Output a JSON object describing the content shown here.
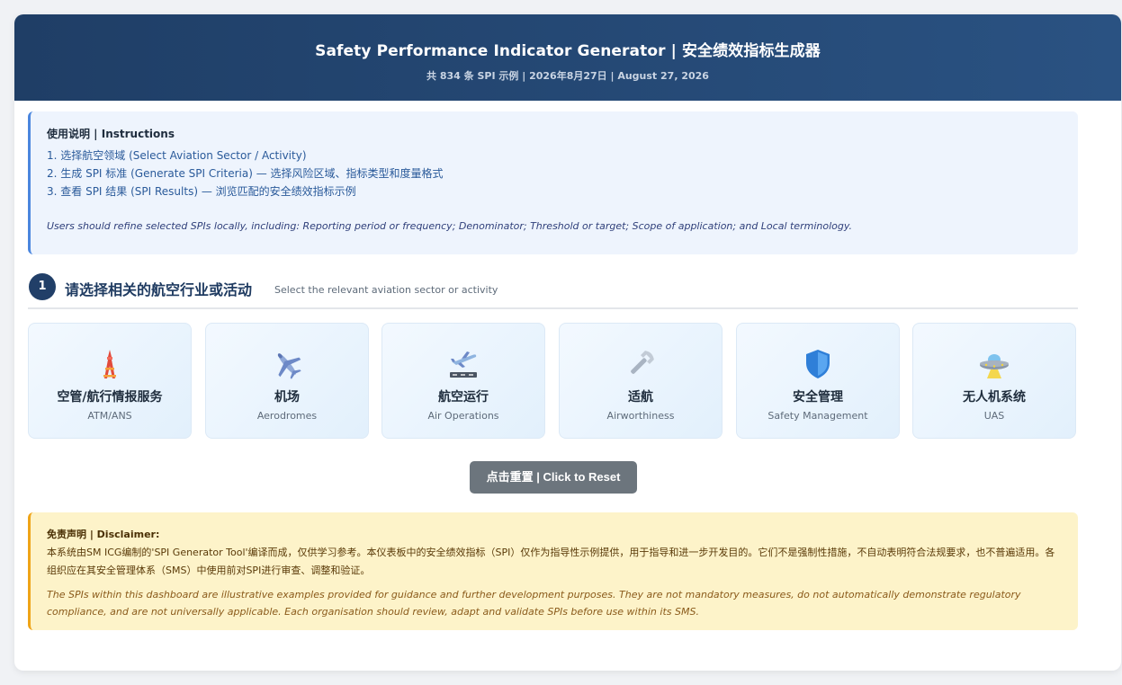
{
  "header": {
    "title": "Safety Performance Indicator Generator | 安全绩效指标生成器",
    "subtitle": "共 834 条 SPI 示例 | 2026年8月27日 | August 27, 2026"
  },
  "instructions": {
    "title": "使用说明 | Instructions",
    "steps": [
      "1. 选择航空领域 (Select Aviation Sector / Activity)",
      "2. 生成 SPI 标准 (Generate SPI Criteria) — 选择风险区域、指标类型和度量格式",
      "3. 查看 SPI 结果 (SPI Results) — 浏览匹配的安全绩效指标示例"
    ],
    "note": "Users should refine selected SPIs locally, including: Reporting period or frequency; Denominator; Threshold or target; Scope of application; and Local terminology."
  },
  "section": {
    "step": "1",
    "title": "请选择相关的航空行业或活动",
    "subtitle": "Select the relevant aviation sector or activity"
  },
  "sectors": [
    {
      "cn": "空管/航行情报服务",
      "en": "ATM/ANS",
      "icon": "tower-icon"
    },
    {
      "cn": "机场",
      "en": "Aerodromes",
      "icon": "airplane-icon"
    },
    {
      "cn": "航空运行",
      "en": "Air Operations",
      "icon": "airplane-runway-icon"
    },
    {
      "cn": "适航",
      "en": "Airworthiness",
      "icon": "wrench-icon"
    },
    {
      "cn": "安全管理",
      "en": "Safety Management",
      "icon": "shield-icon"
    },
    {
      "cn": "无人机系统",
      "en": "UAS",
      "icon": "ufo-icon"
    }
  ],
  "reset": {
    "label": "点击重置 | Click to Reset"
  },
  "disclaimer": {
    "title": "免责声明 | Disclaimer:",
    "cn": "本系统由SM ICG编制的'SPI Generator Tool'编译而成，仅供学习参考。本仪表板中的安全绩效指标（SPI）仅作为指导性示例提供，用于指导和进一步开发目的。它们不是强制性措施，不自动表明符合法规要求，也不普遍适用。各组织应在其安全管理体系（SMS）中使用前对SPI进行审查、调整和验证。",
    "en": "The SPIs within this dashboard are illustrative examples provided for guidance and further development purposes. They are not mandatory measures, do not automatically demonstrate regulatory compliance, and are not universally applicable. Each organisation should review, adapt and validate SPIs before use within its SMS."
  },
  "colors": {
    "header": "#1f3e66",
    "accent_blue": "#4a86de",
    "accent_orange": "#efa417",
    "reset_button": "#6c757d"
  }
}
